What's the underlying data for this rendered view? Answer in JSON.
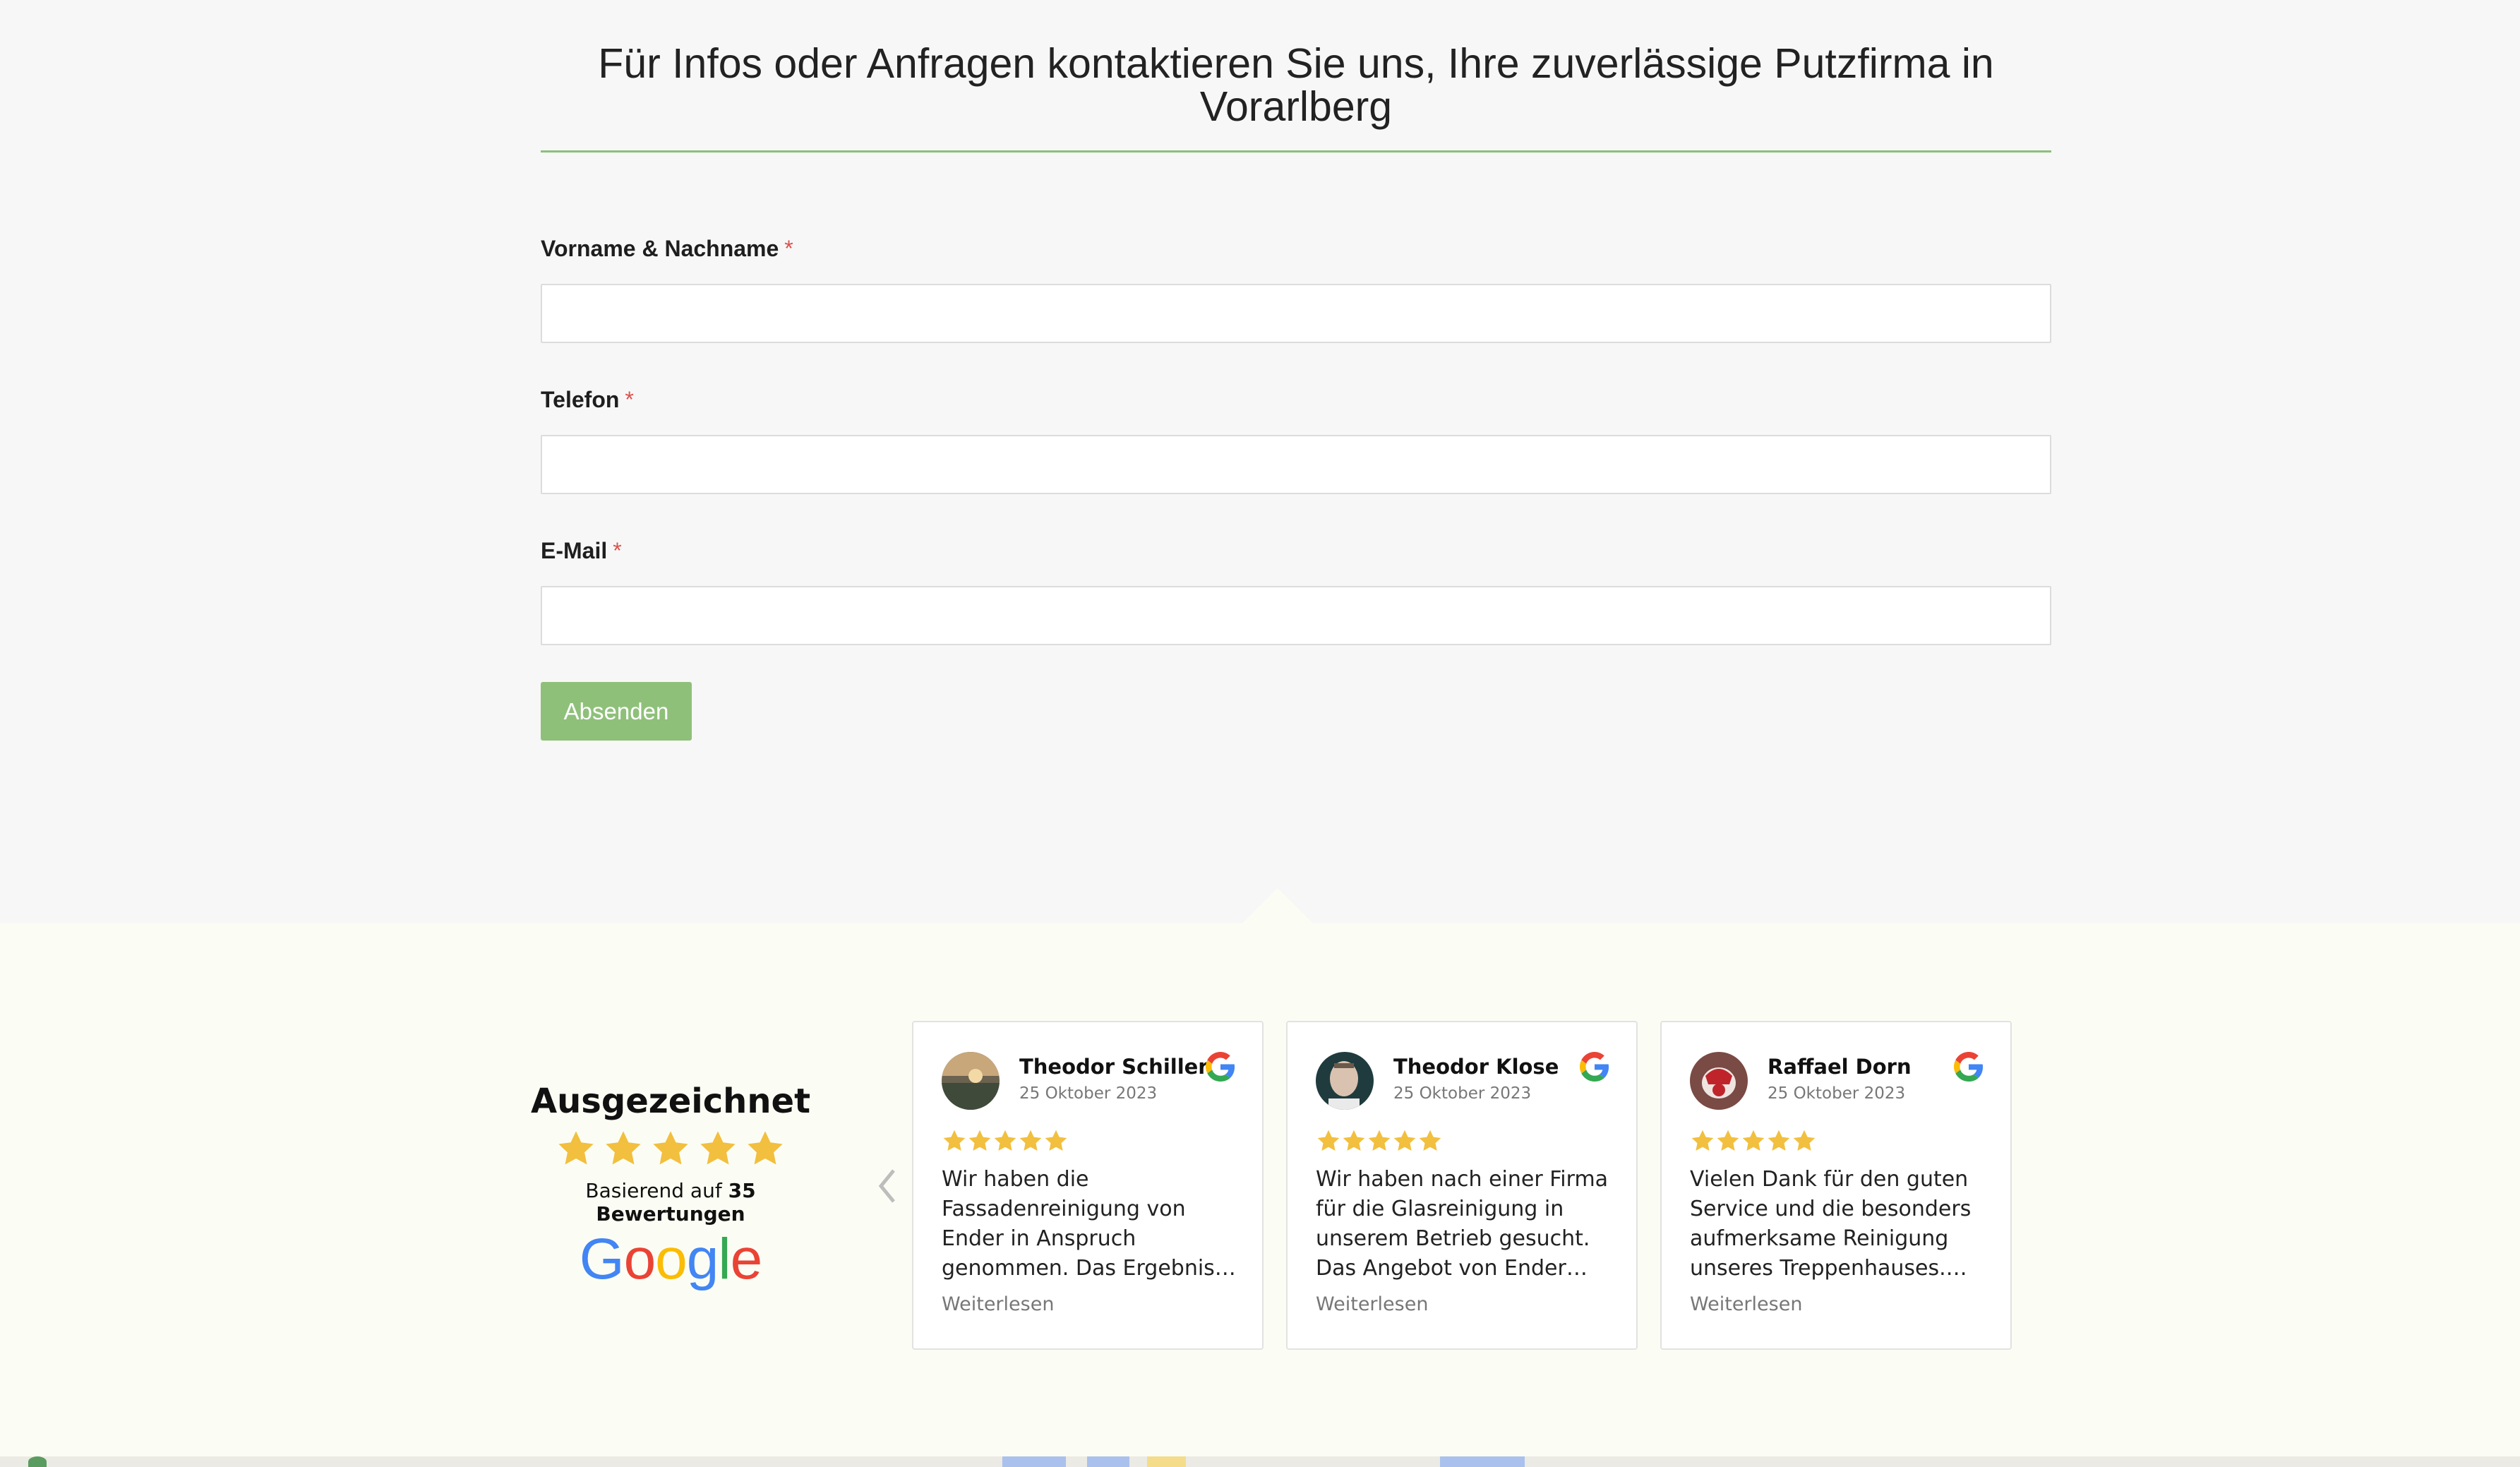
{
  "contact": {
    "heading": "Für Infos oder Anfragen kontaktieren Sie uns, Ihre zuverlässige Putzfirma in Vorarlberg",
    "fields": [
      {
        "label": "Vorname & Nachname",
        "required_mark": "*",
        "value": ""
      },
      {
        "label": "Telefon",
        "required_mark": "*",
        "value": ""
      },
      {
        "label": "E-Mail",
        "required_mark": "*",
        "value": ""
      }
    ],
    "submit_label": "Absenden"
  },
  "reviews": {
    "summary_title": "Ausgezeichnet",
    "summary_rating": 5,
    "basis_prefix": "Basierend auf",
    "basis_count": "35 Bewertungen",
    "provider": "Google",
    "items": [
      {
        "name": "Theodor Schiller",
        "date": "25 Oktober 2023",
        "rating": 5,
        "text": "Wir haben die Fassadenreinigung von Ender in Anspruch genommen. Das Ergebnis…",
        "more_label": "Weiterlesen"
      },
      {
        "name": "Theodor Klose",
        "date": "25 Oktober 2023",
        "rating": 5,
        "text": "Wir haben nach einer Firma für die Glasreinigung in unserem Betrieb gesucht. Das Angebot von Ender…",
        "more_label": "Weiterlesen"
      },
      {
        "name": "Raffael Dorn",
        "date": "25 Oktober 2023",
        "rating": 5,
        "text": "Vielen Dank für den guten Service und die besonders aufmerksame Reinigung unseres Treppenhauses.…",
        "more_label": "Weiterlesen"
      }
    ]
  },
  "colors": {
    "accent_green": "#8fc07a",
    "star_gold": "#f2bf3e",
    "required_red": "#d9534f"
  }
}
